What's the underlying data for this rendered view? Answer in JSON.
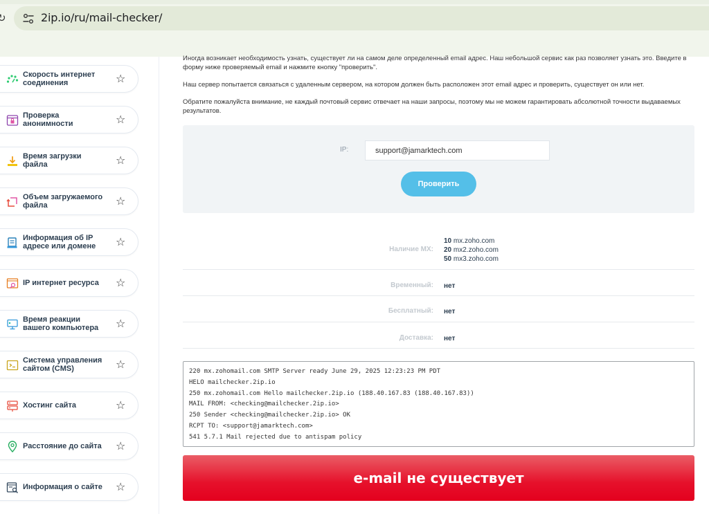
{
  "browser": {
    "url": "2ip.io/ru/mail-checker/"
  },
  "sidebar": {
    "items": [
      {
        "label": "Скорость интернет соединения",
        "icon": "speedometer-icon"
      },
      {
        "label": "Проверка анонимности",
        "icon": "anonymity-lock-icon"
      },
      {
        "label": "Время загрузки файла",
        "icon": "download-icon"
      },
      {
        "label": "Объем загружаемого файла",
        "icon": "file-size-icon"
      },
      {
        "label": "Информация об IP адресе или домене",
        "icon": "ip-info-icon"
      },
      {
        "label": "IP интернет ресурса",
        "icon": "resource-ip-icon"
      },
      {
        "label": "Время реакции вашего компьютера",
        "icon": "reaction-time-icon"
      },
      {
        "label": "Система управления сайтом (CMS)",
        "icon": "cms-icon"
      },
      {
        "label": "Хостинг сайта",
        "icon": "hosting-icon"
      },
      {
        "label": "Расстояние до сайта",
        "icon": "location-pin-icon"
      },
      {
        "label": "Информация о сайте",
        "icon": "site-info-icon"
      }
    ]
  },
  "main": {
    "intro": "Иногда возникает необходимость узнать, существует ли на самом деле определенный email адрес. Наш небольшой сервис как раз позволяет узнать это. Введите в форму ниже проверяемый email и нажмите кнопку \"проверить\".",
    "server_note": "Наш сервер попытается связаться с удаленным сервером, на котором должен быть расположен этот email адрес и проверить, существует он или нет.",
    "warning": "Обратите пожалуйста внимание, не каждый почтовый сервис отвечает на наши запросы, поэтому мы не можем гарантировать абсолютной точности выдаваемых результатов.",
    "form": {
      "ip_label": "IP:",
      "email_value": "support@jamarktech.com",
      "submit_label": "Проверить"
    },
    "results": {
      "mx_label": "Наличие MX:",
      "mx_records": [
        {
          "priority": "10",
          "host": "mx.zoho.com"
        },
        {
          "priority": "20",
          "host": "mx2.zoho.com"
        },
        {
          "priority": "50",
          "host": "mx3.zoho.com"
        }
      ],
      "temporary_label": "Временный:",
      "temporary_value": "нет",
      "free_label": "Бесплатный:",
      "free_value": "нет",
      "delivery_label": "Доставка:",
      "delivery_value": "нет"
    },
    "smtp_log": [
      "220 mx.zohomail.com SMTP Server ready June 29, 2025 12:23:23 PM PDT",
      "HELO mailchecker.2ip.io",
      "250 mx.zohomail.com Hello mailchecker.2ip.io (188.40.167.83 (188.40.167.83))",
      "MAIL FROM: <checking@mailchecker.2ip.io>",
      "250 Sender <checking@mailchecker.2ip.io> OK",
      "RCPT TO: <support@jamarktech.com>",
      "541 5.7.1 Mail rejected due to antispam policy"
    ],
    "verdict": "e-mail не существует"
  },
  "colors": {
    "accent": "#54bfe8",
    "error": "#e6112b",
    "browser_bar": "#f1f5ec"
  }
}
